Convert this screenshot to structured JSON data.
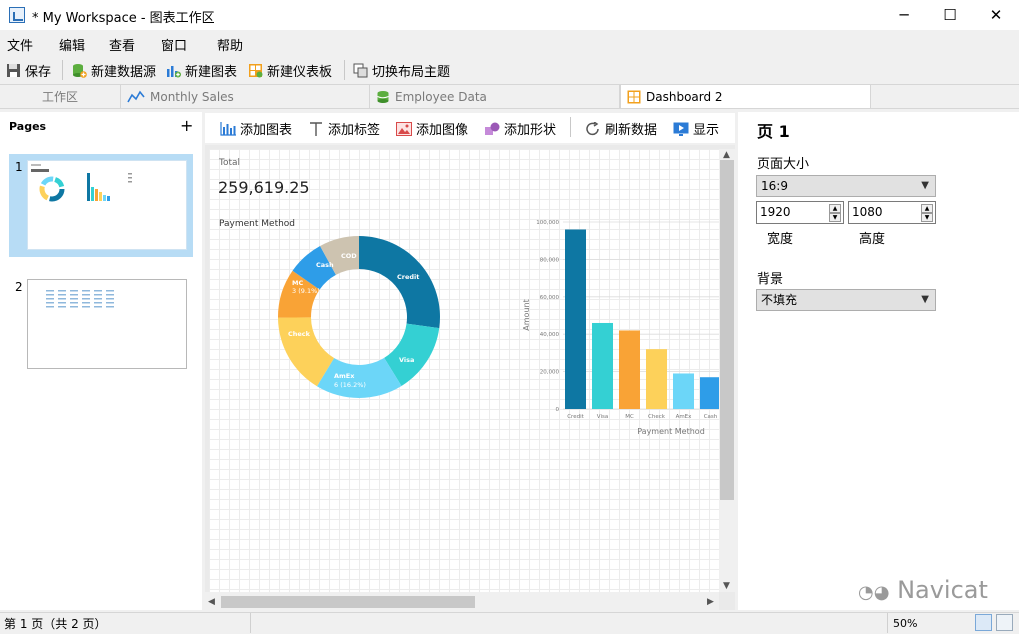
{
  "window": {
    "title": "* My Workspace - 图表工作区",
    "minimize": "─",
    "maximize": "☐",
    "close": "✕"
  },
  "menu": [
    "文件",
    "编辑",
    "查看",
    "窗口",
    "帮助"
  ],
  "toolbar": {
    "save": "保存",
    "new_datasource": "新建数据源",
    "new_chart": "新建图表",
    "new_dashboard": "新建仪表板",
    "switch_theme": "切换布局主题"
  },
  "tabs": [
    {
      "label": "工作区",
      "icon": "none"
    },
    {
      "label": "Monthly Sales",
      "icon": "line-chart-icon"
    },
    {
      "label": "Employee Data",
      "icon": "database-icon"
    },
    {
      "label": "Dashboard 2",
      "icon": "dashboard-icon"
    }
  ],
  "pages": {
    "title": "Pages",
    "add": "+",
    "items": [
      {
        "number": "1"
      },
      {
        "number": "2"
      }
    ]
  },
  "canvas_toolbar": {
    "add_chart": "添加图表",
    "add_label": "添加标签",
    "add_image": "添加图像",
    "add_shape": "添加形状",
    "refresh": "刷新数据",
    "display": "显示"
  },
  "dashboard": {
    "total_label": "Total",
    "total_value": "259,619.25",
    "donut_title": "Payment Method",
    "donut_labels": {
      "credit": "Credit",
      "visa": "Visa",
      "amex": "AmEx",
      "amex_pct": "6 (16.2%)",
      "check": "Check",
      "mc": "MC",
      "mc_pct": "3 (9.1%)",
      "cash": "Cash",
      "cod": "COD"
    }
  },
  "chart_data": [
    {
      "type": "pie",
      "title": "Payment Method",
      "categories": [
        "Credit",
        "Visa",
        "AmEx",
        "Check",
        "MC",
        "Cash",
        "COD"
      ],
      "values": [
        25.2,
        13.0,
        16.2,
        15.0,
        9.1,
        6.8,
        7.4
      ],
      "colors": [
        "#0e77a3",
        "#34d0d3",
        "#6cd6f8",
        "#fdd15a",
        "#f9a336",
        "#2e9de8",
        "#cdc3b0"
      ],
      "hole": true
    },
    {
      "type": "bar",
      "categories": [
        "Credit",
        "Visa",
        "MC",
        "Check",
        "AmEx",
        "Cash"
      ],
      "values": [
        96000,
        46000,
        42000,
        32000,
        19000,
        17000
      ],
      "colors": [
        "#0e77a3",
        "#34d0d3",
        "#f9a336",
        "#fdd15a",
        "#6cd6f8",
        "#2e9de8"
      ],
      "xlabel": "Payment Method",
      "ylabel": "Amount",
      "ylim": [
        0,
        100000
      ],
      "yticks": [
        "0",
        "20,000",
        "40,000",
        "60,000",
        "80,000",
        "100,000"
      ],
      "grid": true
    }
  ],
  "properties": {
    "title": "页 1",
    "page_size_label": "页面大小",
    "page_size": "16:9",
    "width_value": "1920",
    "height_value": "1080",
    "width_label": "宽度",
    "height_label": "高度",
    "background_label": "背景",
    "background": "不填充"
  },
  "status": {
    "page_info": "第 1 页（共 2 页）",
    "zoom": "50%",
    "watermark": "Navicat"
  }
}
